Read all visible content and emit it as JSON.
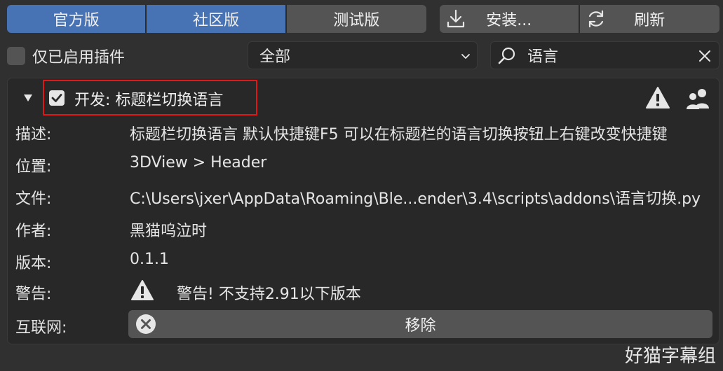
{
  "tabs": {
    "official": "官方版",
    "community": "社区版",
    "testing": "测试版"
  },
  "actions": {
    "install": "安装...",
    "refresh": "刷新"
  },
  "filter": {
    "enabled_only_label": "仅已启用插件",
    "category_value": "全部",
    "search_value": "语言"
  },
  "addon": {
    "title": "开发: 标题栏切换语言",
    "labels": {
      "description": "描述:",
      "location": "位置:",
      "file": "文件:",
      "author": "作者:",
      "version": "版本:",
      "warning": "警告:",
      "internet": "互联网:"
    },
    "values": {
      "description": "标题栏切换语言 默认快捷键F5 可以在标题栏的语言切换按钮上右键改变快捷键",
      "location": "3DView > Header",
      "file": "C:\\Users\\jxer\\AppData\\Roaming\\Ble...ender\\3.4\\scripts\\addons\\语言切换.py",
      "author": "黑猫呜泣时",
      "version": "0.1.1",
      "warning": "警告! 不支持2.91以下版本"
    },
    "remove_label": "移除"
  },
  "watermark": "好猫字幕组",
  "colors": {
    "accent": "#4772b3",
    "highlight_box": "#e01818",
    "background": "#303030",
    "panel": "#282828",
    "button": "#545454"
  },
  "icons": [
    "download-icon",
    "refresh-icon",
    "search-icon",
    "clear-icon",
    "chevron-down-icon",
    "expand-triangle-icon",
    "checkbox-checked-icon",
    "warning-icon",
    "users-icon",
    "remove-x-icon"
  ]
}
